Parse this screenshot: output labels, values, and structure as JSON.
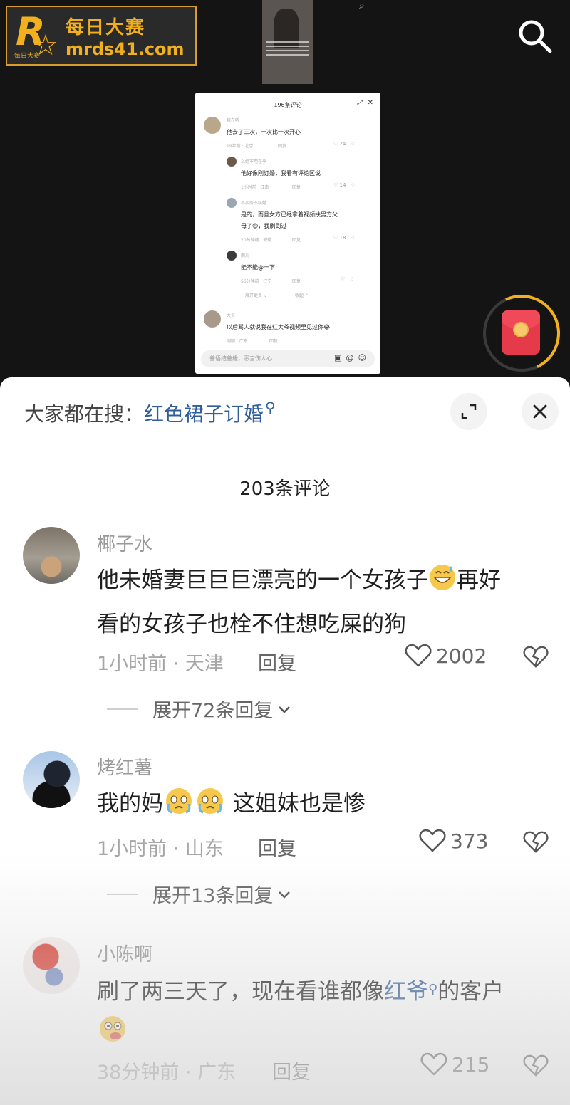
{
  "watermark": {
    "brand_cn": "每日大赛",
    "url": "mrds41.com",
    "mark_small": "每日大赛"
  },
  "mini_panel": {
    "title": "196条评论",
    "comments": [
      {
        "name": "我在听",
        "text": "他去了三次，一次比一次开心",
        "meta": "19年前 · 北京",
        "reply": "回复",
        "likes": "24"
      },
      {
        "name": "么姐不用在乎",
        "text": "他好像刚订婚，我看有评论区说",
        "meta": "1小时前 · 江南",
        "reply": "回复",
        "likes": "14"
      },
      {
        "name": "不买房不结婚",
        "text": "是的，而且女方已经拿着视频扶男方父",
        "text2": "母了😄，我刷到过",
        "meta": "20分钟前 · 安徽",
        "reply": "回复",
        "likes": "18"
      },
      {
        "name": "雨儿",
        "text": "能不能@一下",
        "meta": "56分钟前 · 辽宁",
        "reply": "回复",
        "likes": ""
      },
      {
        "name": "大卡",
        "text": "以后骂人就说我在红大爷视频里见过你😂",
        "meta": "刚刚 · 广东",
        "reply": "回复",
        "likes": ""
      }
    ],
    "expand_more": "展开更多",
    "collapse": "收起",
    "input_placeholder": "善语结善缘，恶言伤人心"
  },
  "search": {
    "prefix": "大家都在搜：",
    "term": "红色裙子订婚"
  },
  "header": {
    "comment_count": "203条评论"
  },
  "comments": [
    {
      "name": "椰子水",
      "text_line1": "他未婚妻巨巨巨漂亮的一个女孩子",
      "text_line1_after": "再好",
      "text_line2": "看的女孩子也栓不住想吃屎的狗",
      "meta": "1小时前 · 天津",
      "reply": "回复",
      "likes": "2002",
      "expand": "展开72条回复"
    },
    {
      "name": "烤红薯",
      "text_before": "我的妈",
      "text_after": "这姐妹也是惨",
      "meta": "1小时前 · 山东",
      "reply": "回复",
      "likes": "373",
      "expand": "展开13条回复"
    },
    {
      "name": "小陈啊",
      "text_before": "刷了两三天了，现在看谁都像",
      "text_link": "红爷",
      "text_after": "的客户",
      "meta": "38分钟前 · 广东",
      "reply": "回复",
      "likes": "215"
    }
  ],
  "colors": {
    "accent_link": "#2f5e99",
    "watermark_gold": "#f2b01e",
    "redpacket": "#e53a4a"
  },
  "icons": [
    "search-icon",
    "expand-icon",
    "close-icon",
    "heart-icon",
    "dislike-icon",
    "chevron-down-icon",
    "red-packet-icon"
  ]
}
